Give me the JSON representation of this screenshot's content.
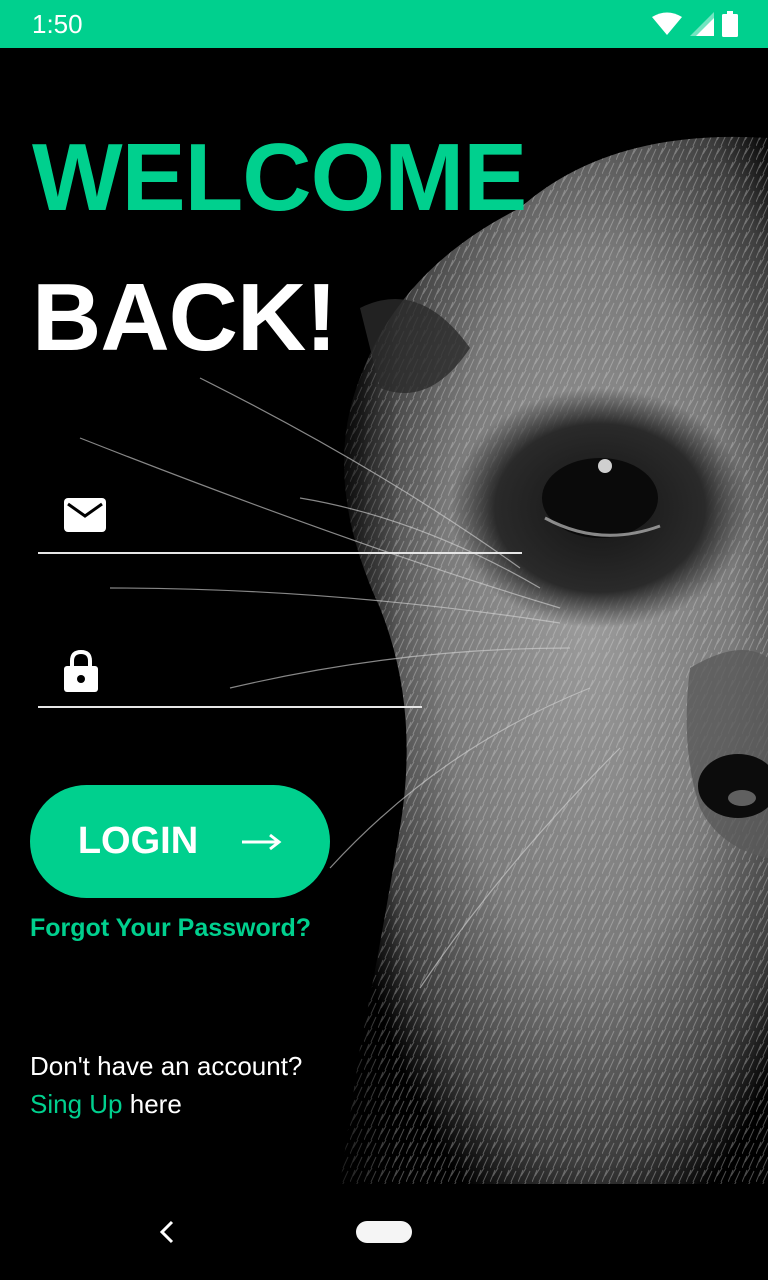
{
  "status_bar": {
    "time": "1:50",
    "icons": [
      "wifi-icon",
      "signal-icon",
      "battery-icon"
    ],
    "background": "#00d08e"
  },
  "header": {
    "title_line1": "WELCOME",
    "title_line2": "BACK!"
  },
  "form": {
    "email": {
      "icon": "mail-icon",
      "value": "",
      "placeholder": ""
    },
    "password": {
      "icon": "lock-icon",
      "value": "",
      "placeholder": ""
    },
    "login_label": "LOGIN",
    "login_icon": "arrow-right-icon",
    "forgot_password": "Forgot Your Password?"
  },
  "footer": {
    "prompt": "Don't have an account?",
    "signup_link": "Sing Up",
    "signup_suffix": "here"
  },
  "nav_bar": {
    "icons": [
      "back-icon",
      "home-pill-icon"
    ]
  },
  "colors": {
    "accent": "#00d08e",
    "background": "#000000",
    "text": "#ffffff"
  }
}
